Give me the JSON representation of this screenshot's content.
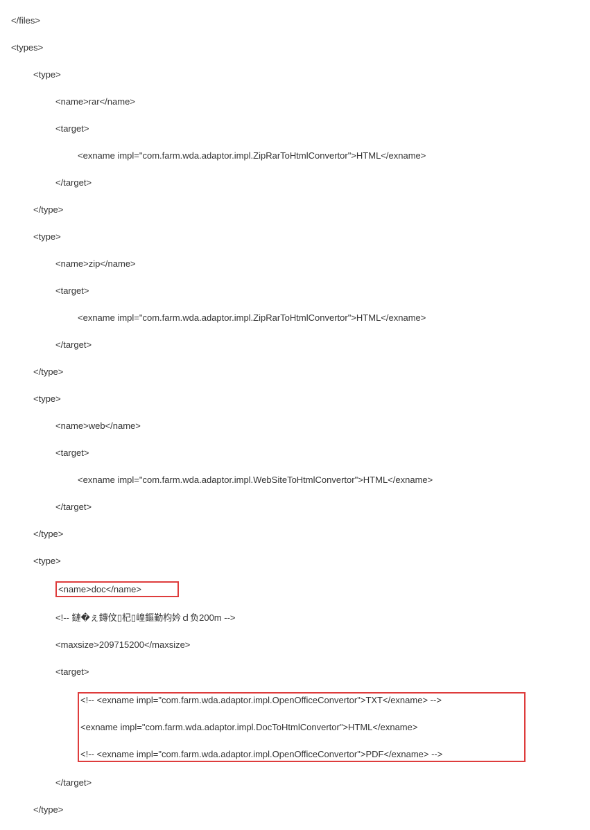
{
  "lines": {
    "l0": "</files>",
    "l1": "<types>",
    "l2": "<type>",
    "l3": "<name>rar</name>",
    "l4": "<target>",
    "l5": "<exname impl=\"com.farm.wda.adaptor.impl.ZipRarToHtmlConvertor\">HTML</exname>",
    "l6": "</target>",
    "l7": "</type>",
    "l8": "<type>",
    "l9": "<name>zip</name>",
    "l10": "<target>",
    "l11": "<exname impl=\"com.farm.wda.adaptor.impl.ZipRarToHtmlConvertor\">HTML</exname>",
    "l12": "</target>",
    "l13": "</type>",
    "l14": "<type>",
    "l15": "<name>web</name>",
    "l16": "<target>",
    "l17": "<exname impl=\"com.farm.wda.adaptor.impl.WebSiteToHtmlConvertor\">HTML</exname>",
    "l18": "</target>",
    "l19": "</type>",
    "l20": "<type>",
    "l21": "<name>doc</name>",
    "l22": "<!-- 鏈�ぇ鏄伩▯杞▯崲鏂勤枃妗ｄ负200m -->",
    "l23": "<maxsize>209715200</maxsize>",
    "l24": "<target>",
    "l25": "<!-- <exname impl=\"com.farm.wda.adaptor.impl.OpenOfficeConvertor\">TXT</exname> -->",
    "l26": "<exname impl=\"com.farm.wda.adaptor.impl.DocToHtmlConvertor\">HTML</exname>",
    "l27": "<!-- <exname impl=\"com.farm.wda.adaptor.impl.OpenOfficeConvertor\">PDF</exname> -->",
    "l28": "</target>",
    "l29": "</type>"
  }
}
